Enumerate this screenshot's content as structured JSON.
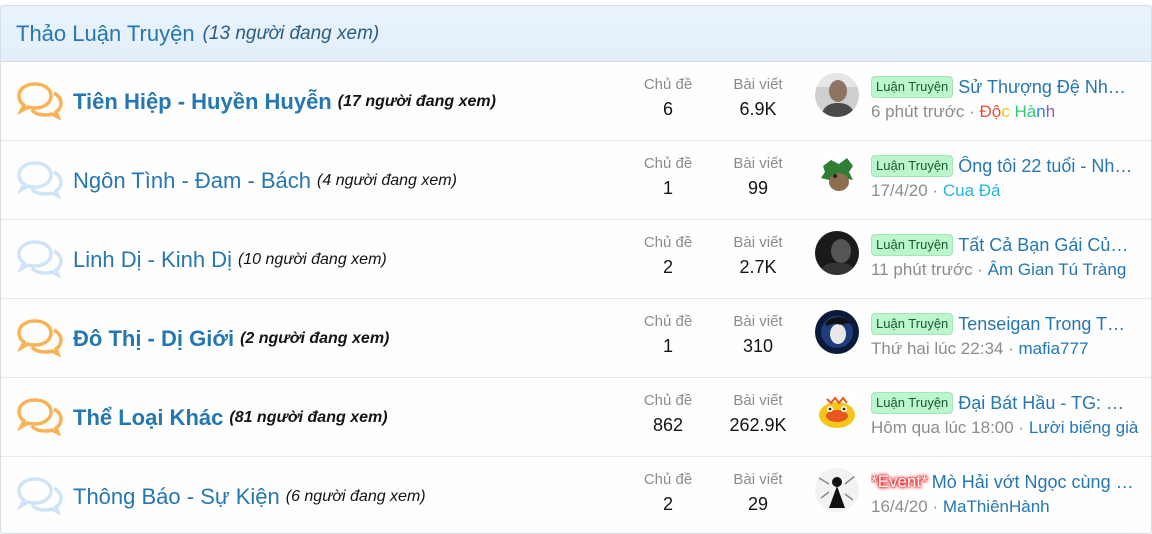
{
  "forum_block": {
    "title": "Thảo Luận Truyện",
    "viewers": "(13 người đang xem)"
  },
  "stat_labels": {
    "threads": "Chủ đề",
    "posts": "Bài viết"
  },
  "colors": {
    "accent": "#2577b1",
    "unread_icon": "#f9b356",
    "read_icon": "#cfe4f7",
    "label_bg": "#bdf5cd"
  },
  "nodes": [
    {
      "name": "Tiên Hiệp - Huyền Huyễn",
      "viewers": "(17 người đang xem)",
      "unread": true,
      "threads": "6",
      "posts": "6.9K",
      "label": "Luận Truyện",
      "thread_title": "Sử Thượng Đệ Nhất …",
      "time": "6 phút trước",
      "user": "Độc Hành"
    },
    {
      "name": "Ngôn Tình - Đam - Bách",
      "viewers": "(4 người đang xem)",
      "unread": false,
      "threads": "1",
      "posts": "99",
      "label": "Luận Truyện",
      "thread_title": "Ông tôi 22 tuổi - Nh…",
      "time": "17/4/20",
      "user": "Cua Đá"
    },
    {
      "name": "Linh Dị - Kinh Dị",
      "viewers": "(10 người đang xem)",
      "unread": false,
      "threads": "2",
      "posts": "2.7K",
      "label": "Luận Truyện",
      "thread_title": "Tất Cả Bạn Gái Của T…",
      "time": "11 phút trước",
      "user": "Âm Gian Tú Tràng"
    },
    {
      "name": "Đô Thị - Dị Giới",
      "viewers": "(2 người đang xem)",
      "unread": true,
      "threads": "1",
      "posts": "310",
      "label": "Luận Truyện",
      "thread_title": "Tenseigan Trong Thế …",
      "time": "Thứ hai lúc 22:34",
      "user": "mafia777"
    },
    {
      "name": "Thể Loại Khác",
      "viewers": "(81 người đang xem)",
      "unread": true,
      "threads": "862",
      "posts": "262.9K",
      "label": "Luận Truyện",
      "thread_title": "Đại Bát Hầu - TG: Giá…",
      "time": "Hôm qua lúc 18:00",
      "user": "Lười biếng già"
    },
    {
      "name": "Thông Báo - Sự Kiện",
      "viewers": "(6 người đang xem)",
      "unread": false,
      "threads": "2",
      "posts": "29",
      "label": "*Event*",
      "thread_title": "Mò Hải vớt Ngọc cùng S…",
      "time": "16/4/20",
      "user": "MaThiênHành"
    }
  ]
}
